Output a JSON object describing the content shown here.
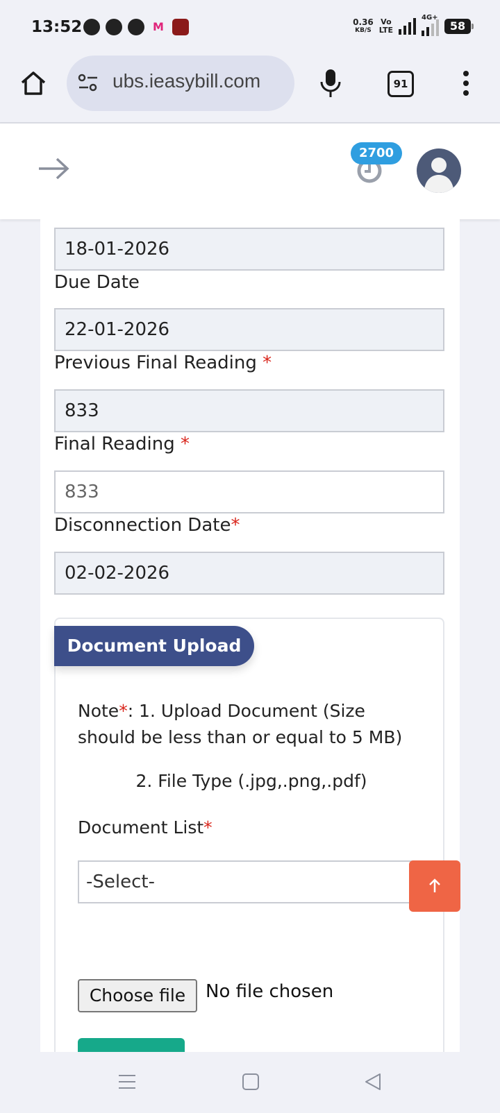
{
  "status_bar": {
    "time": "13:52",
    "net_speed_value": "0.36",
    "net_speed_unit": "KB/S",
    "volte_top": "Vo",
    "volte_bottom": "LTE",
    "network_type": "4G+",
    "battery": "58"
  },
  "browser": {
    "url": "ubs.ieasybill.com",
    "tab_count": "91"
  },
  "header": {
    "badge_count": "2700"
  },
  "form": {
    "bill_date_value": "18-01-2026",
    "due_date_label": "Due Date",
    "due_date_value": "22-01-2026",
    "previous_final_reading_label": "Previous Final Reading",
    "previous_final_reading_value": "833",
    "final_reading_label": "Final Reading",
    "final_reading_placeholder": "833",
    "disconnection_date_label": "Disconnection Date",
    "disconnection_date_value": "02-02-2026",
    "required_mark": "*"
  },
  "document_upload": {
    "tab_label": "Document Upload",
    "note_prefix": "Note",
    "note_line1": ": 1. Upload Document (Size should be less than or equal to 5 MB)",
    "note_line2": "2. File Type (.jpg,.png,.pdf)",
    "document_list_label": "Document List",
    "select_value": "-Select-",
    "choose_file_label": "Choose file",
    "file_status": "No file chosen"
  },
  "colors": {
    "primary": "#3d4f8a",
    "badge": "#2f9ee0",
    "scroll_top": "#ef6545",
    "required": "#d9261c",
    "submit": "#16a98a"
  }
}
